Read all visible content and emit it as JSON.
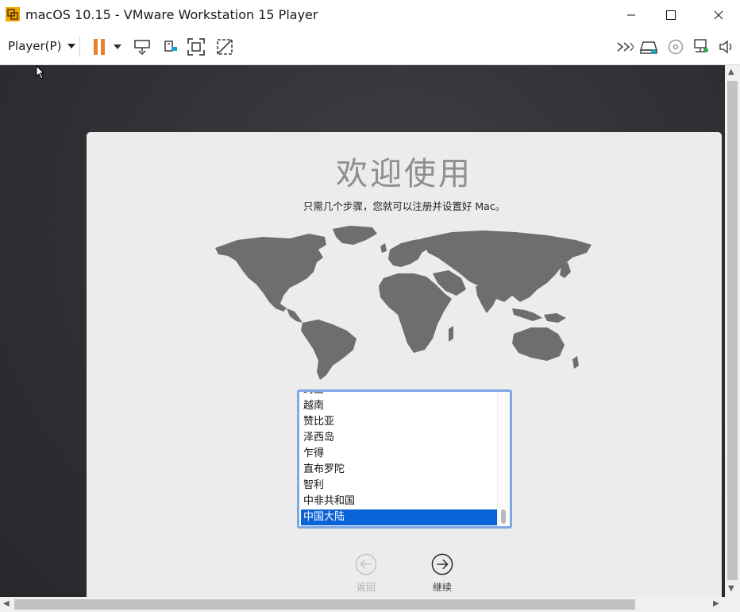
{
  "window": {
    "title": "macOS 10.15 - VMware Workstation 15 Player",
    "minimize_label": "minimize",
    "maximize_label": "maximize",
    "close_label": "close"
  },
  "toolbar": {
    "player_menu_label": "Player(P)",
    "accent_color": "#e8812e"
  },
  "welcome": {
    "title": "欢迎使用",
    "subtitle": "只需几个步骤，您就可以注册并设置好 Mac。"
  },
  "country_list": {
    "items": [
      "约旦",
      "越南",
      "赞比亚",
      "泽西岛",
      "乍得",
      "直布罗陀",
      "智利",
      "中非共和国",
      "中国大陆"
    ],
    "selected": "中国大陆",
    "selected_color": "#0b63d8"
  },
  "navigation": {
    "back_label": "返回",
    "continue_label": "继续"
  }
}
